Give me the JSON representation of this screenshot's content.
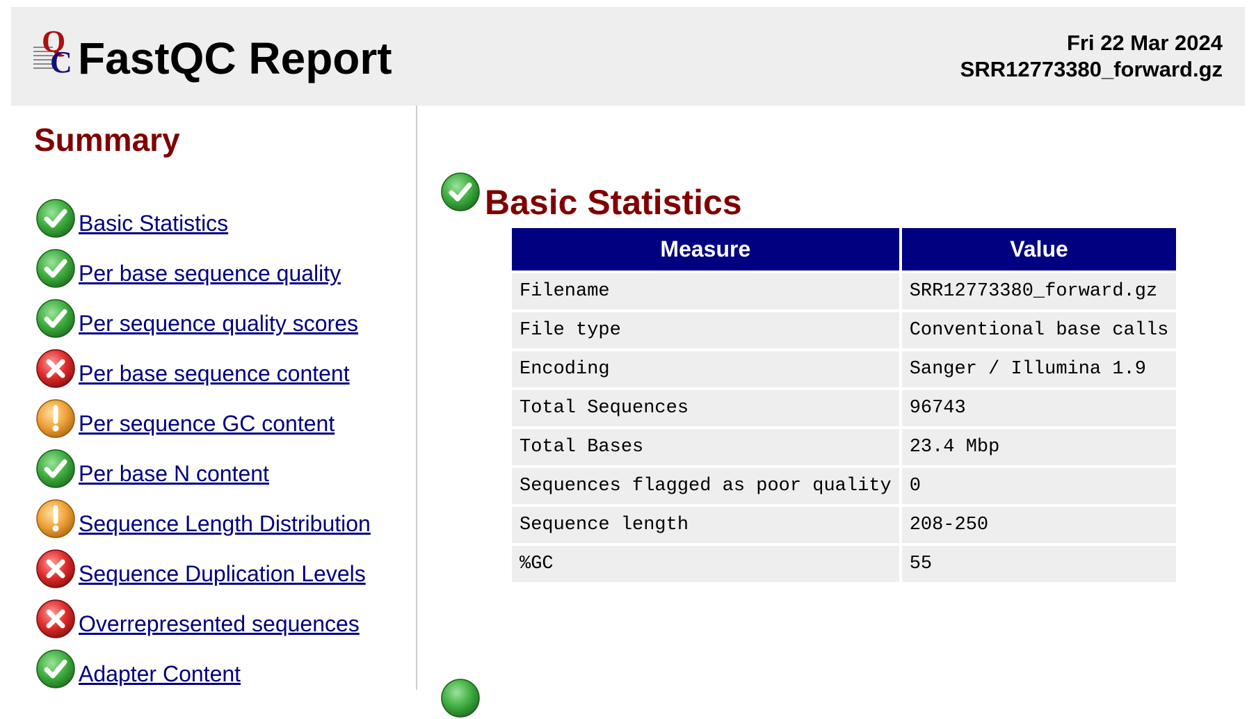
{
  "header": {
    "title": "FastQC Report",
    "date": "Fri 22 Mar 2024",
    "filename": "SRR12773380_forward.gz",
    "logo_letters": "QC"
  },
  "summary": {
    "title": "Summary",
    "modules": [
      {
        "label": "Basic Statistics",
        "status": "pass",
        "icon": "pass-icon"
      },
      {
        "label": "Per base sequence quality",
        "status": "pass",
        "icon": "pass-icon"
      },
      {
        "label": "Per sequence quality scores",
        "status": "pass",
        "icon": "pass-icon"
      },
      {
        "label": "Per base sequence content",
        "status": "fail",
        "icon": "fail-icon"
      },
      {
        "label": "Per sequence GC content",
        "status": "warn",
        "icon": "warn-icon"
      },
      {
        "label": "Per base N content",
        "status": "pass",
        "icon": "pass-icon"
      },
      {
        "label": "Sequence Length Distribution",
        "status": "warn",
        "icon": "warn-icon"
      },
      {
        "label": "Sequence Duplication Levels",
        "status": "fail",
        "icon": "fail-icon"
      },
      {
        "label": "Overrepresented sequences",
        "status": "fail",
        "icon": "fail-icon"
      },
      {
        "label": "Adapter Content",
        "status": "pass",
        "icon": "pass-icon"
      }
    ]
  },
  "main": {
    "section_title": "Basic Statistics",
    "section_status": "pass",
    "table": {
      "headers": [
        "Measure",
        "Value"
      ],
      "rows": [
        [
          "Filename",
          "SRR12773380_forward.gz"
        ],
        [
          "File type",
          "Conventional base calls"
        ],
        [
          "Encoding",
          "Sanger / Illumina 1.9"
        ],
        [
          "Total Sequences",
          "96743"
        ],
        [
          "Total Bases",
          "23.4 Mbp"
        ],
        [
          "Sequences flagged as poor quality",
          "0"
        ],
        [
          "Sequence length",
          "208-250"
        ],
        [
          "%GC",
          "55"
        ]
      ]
    }
  },
  "colors": {
    "header_bg": "#eeeeee",
    "heading": "#800000",
    "link": "#000080",
    "table_header_bg": "#000080",
    "table_cell_bg": "#eeeeee",
    "pass": "#33aa33",
    "warn": "#ee9922",
    "fail": "#dd2222"
  }
}
